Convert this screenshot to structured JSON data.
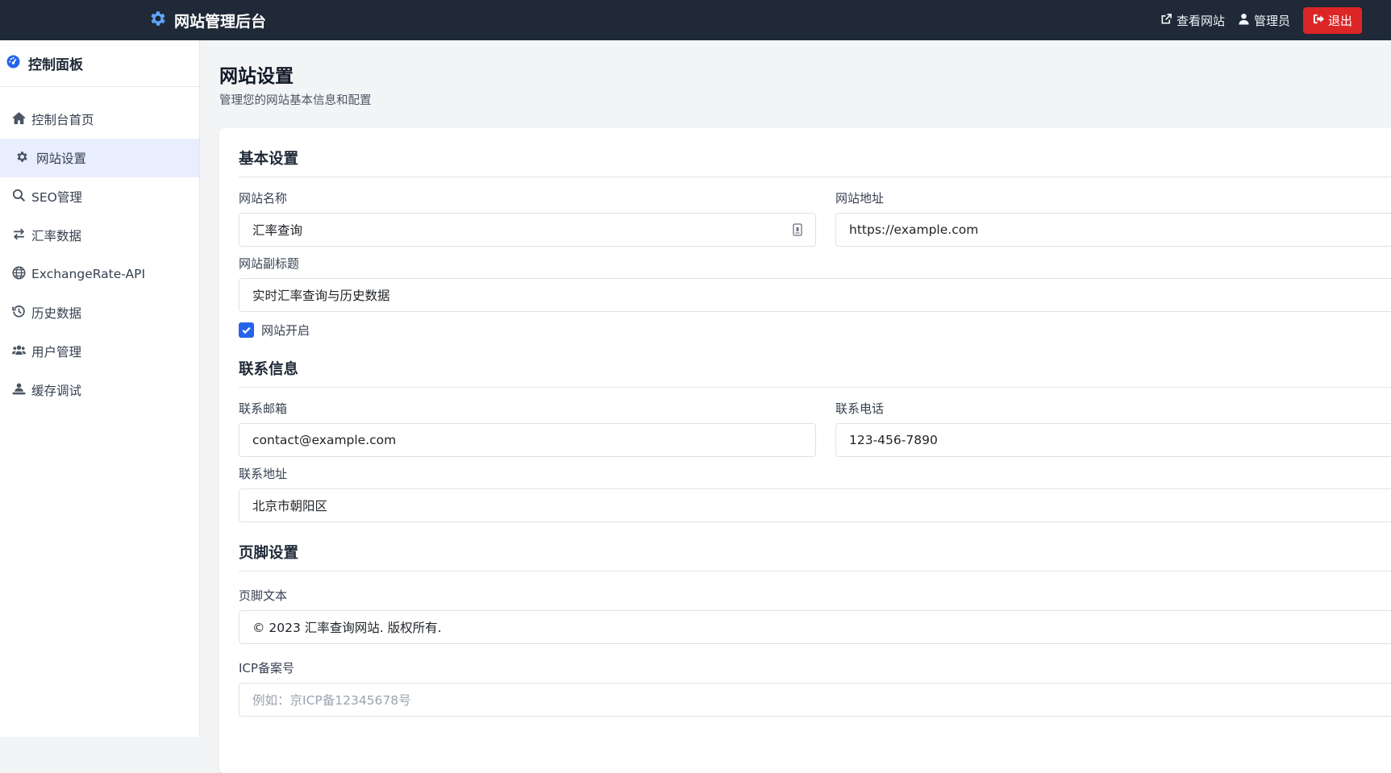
{
  "navbar": {
    "brand_title": "网站管理后台",
    "view_site_label": "查看网站",
    "admin_label": "管理员",
    "logout_label": "退出"
  },
  "sidebar": {
    "header": "控制面板",
    "items": [
      {
        "label": "控制台首页",
        "icon": "home-icon"
      },
      {
        "label": "网站设置",
        "icon": "gear-icon",
        "active": true
      },
      {
        "label": "SEO管理",
        "icon": "search-icon"
      },
      {
        "label": "汇率数据",
        "icon": "exchange-icon"
      },
      {
        "label": "ExchangeRate-API",
        "icon": "globe-icon"
      },
      {
        "label": "历史数据",
        "icon": "history-icon"
      },
      {
        "label": "用户管理",
        "icon": "users-icon"
      },
      {
        "label": "缓存调试",
        "icon": "debug-icon"
      }
    ]
  },
  "page": {
    "title": "网站设置",
    "subtitle": "管理您的网站基本信息和配置"
  },
  "basic": {
    "section_title": "基本设置",
    "site_name_label": "网站名称",
    "site_name_value": "汇率查询",
    "site_url_label": "网站地址",
    "site_url_value": "https://example.com",
    "subtitle_label": "网站副标题",
    "subtitle_value": "实时汇率查询与历史数据",
    "site_open_label": "网站开启",
    "site_open_checked": true
  },
  "contact": {
    "section_title": "联系信息",
    "email_label": "联系邮箱",
    "email_value": "contact@example.com",
    "phone_label": "联系电话",
    "phone_value": "123-456-7890",
    "address_label": "联系地址",
    "address_value": "北京市朝阳区"
  },
  "footer": {
    "section_title": "页脚设置",
    "text_label": "页脚文本",
    "text_value": "© 2023 汇率查询网站. 版权所有.",
    "icp_label": "ICP备案号",
    "icp_placeholder": "例如：京ICP备12345678号"
  },
  "colors": {
    "navbar_bg": "#1f2937",
    "logout_bg": "#dc2626",
    "accent": "#2563eb",
    "active_item_bg": "#e8eefc"
  }
}
